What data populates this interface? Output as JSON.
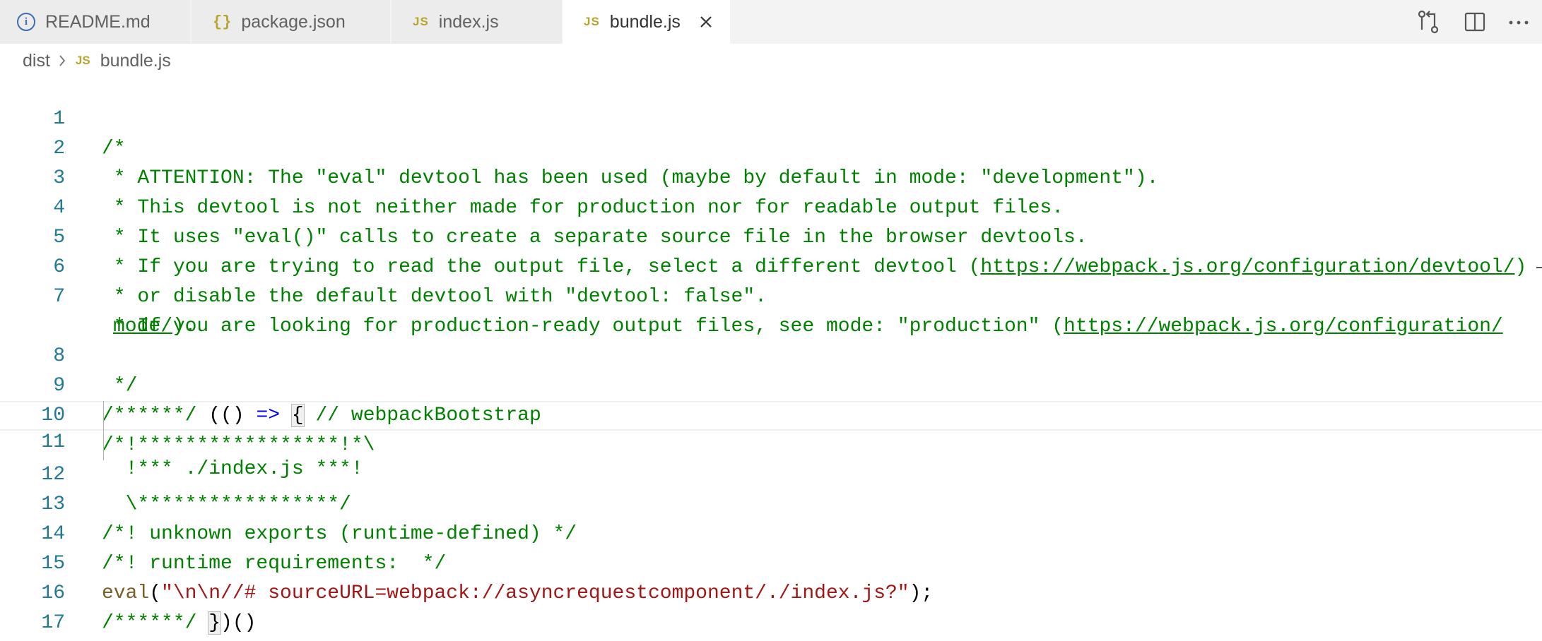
{
  "tabs": [
    {
      "label": "README.md",
      "icon": "info-icon"
    },
    {
      "label": "package.json",
      "icon": "braces-icon"
    },
    {
      "label": "index.js",
      "icon": "js-icon"
    },
    {
      "label": "bundle.js",
      "icon": "js-icon",
      "active": true
    }
  ],
  "tab_icon_text": {
    "braces": "{}",
    "js": "JS",
    "info": "i"
  },
  "breadcrumb": {
    "folder": "dist",
    "file_icon": "JS",
    "file": "bundle.js"
  },
  "editor": {
    "line_numbers": [
      "1",
      "2",
      "3",
      "4",
      "5",
      "6",
      "7",
      "8",
      "9",
      "10",
      "11",
      "12",
      "13",
      "14",
      "15",
      "16",
      "17"
    ],
    "lines": {
      "l1": "/*",
      "l2": " * ATTENTION: The \"eval\" devtool has been used (maybe by default in mode: \"development\").",
      "l3": " * This devtool is not neither made for production nor for readable output files.",
      "l4": " * It uses \"eval()\" calls to create a separate source file in the browser devtools.",
      "l5_pre": " * If you are trying to read the output file, select a different devtool (",
      "l5_link": "https://webpack.js.org/configuration/devtool/",
      "l5_post": ")",
      "l6": " * or disable the default devtool with \"devtool: false\".",
      "l7_pre": " * If you are looking for production-ready output files, see mode: \"production\" (",
      "l7_link_a": "https://webpack.js.org/configuration/",
      "l7_link_b": "mode/",
      "l7_post": ").",
      "l8": " */",
      "l9_comment_a": "/******/ ",
      "l9_paren": "(() ",
      "l9_arrow": "=>",
      "l9_space": " ",
      "l9_brace": "{",
      "l9_comment_b": " // webpackBootstrap",
      "l10": "/*!*****************!*\\",
      "l11": "  !*** ./index.js ***!",
      "l12": "  \\*****************/",
      "l13": "/*! unknown exports (runtime-defined) */",
      "l14": "/*! runtime requirements:  */",
      "l15_fn": "eval",
      "l15_open": "(",
      "l15_str": "\"\\n\\n//# sourceURL=webpack://asyncrequestcomponent/./index.js?\"",
      "l15_close": ");",
      "l16_comment": "/******/ ",
      "l16_brace": "}",
      "l16_rest": ")()",
      "l17": ";"
    }
  },
  "colors": {
    "comment": "#008000",
    "keyword": "#0000ff",
    "function": "#795e26",
    "string": "#a31515",
    "line_number": "#237893"
  }
}
